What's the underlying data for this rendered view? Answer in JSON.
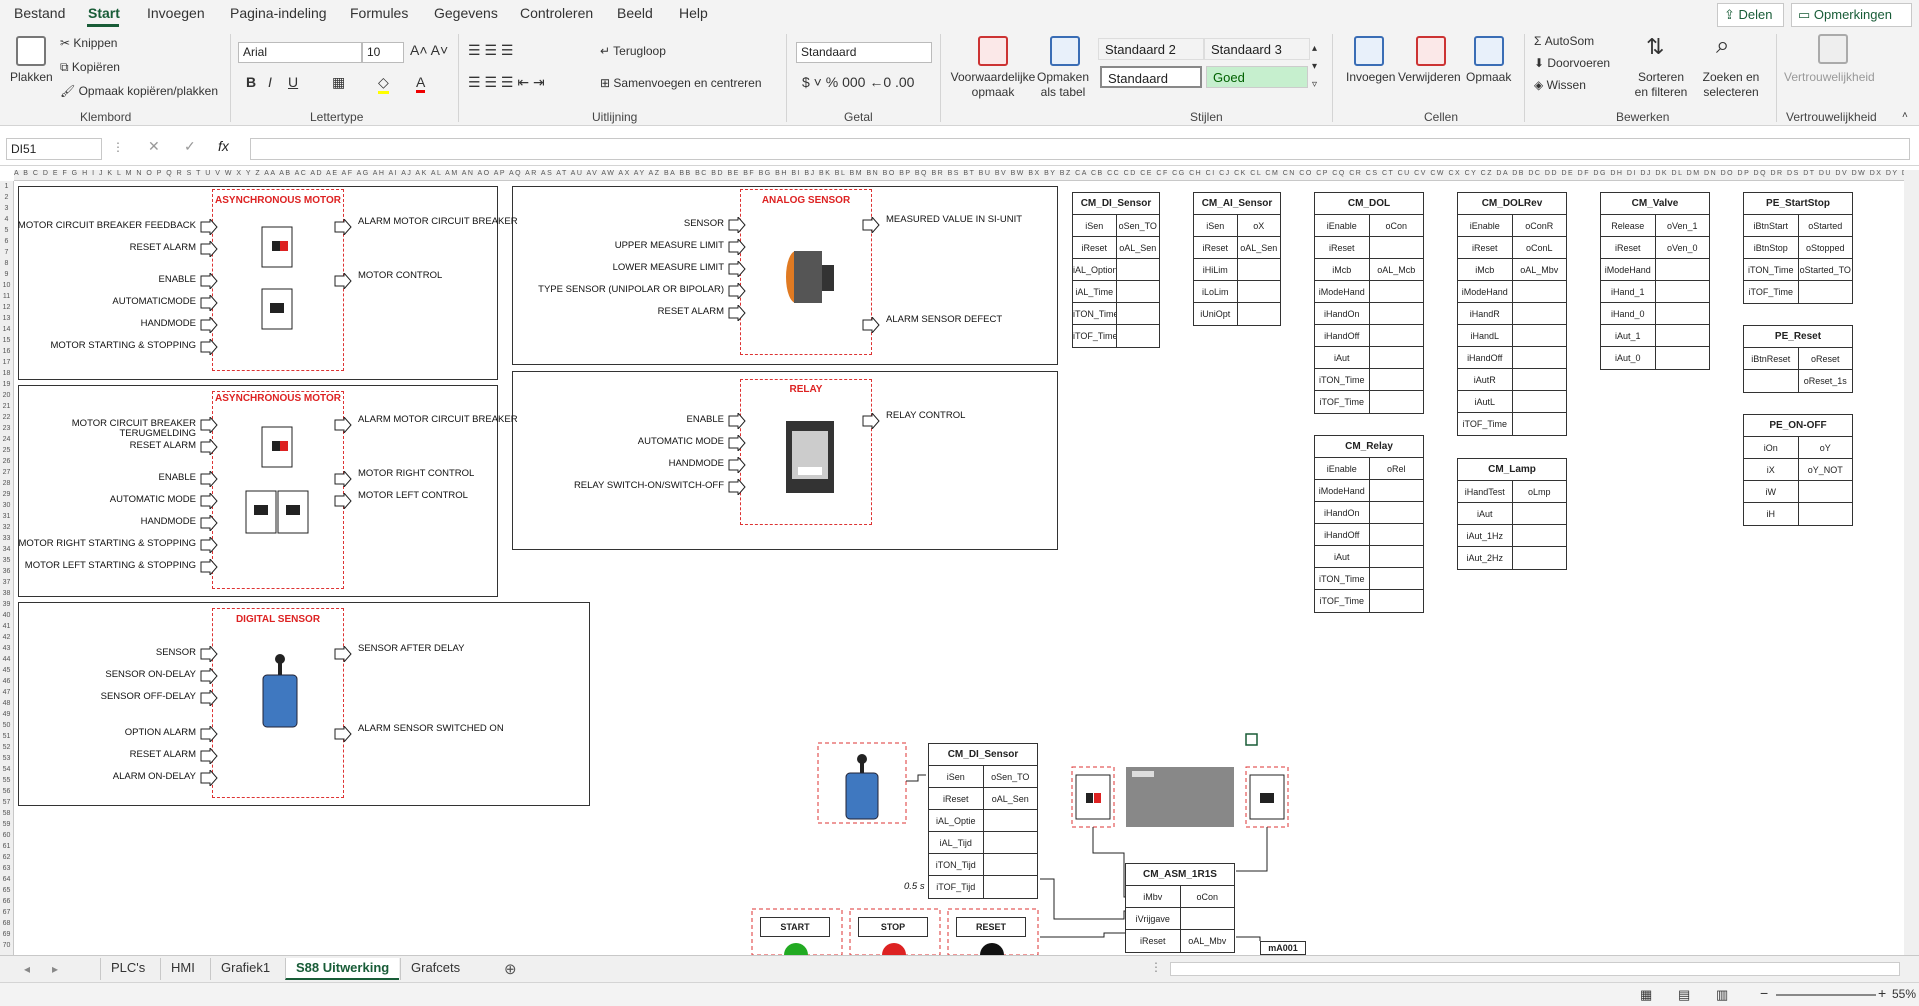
{
  "menu": [
    "Bestand",
    "Start",
    "Invoegen",
    "Pagina-indeling",
    "Formules",
    "Gegevens",
    "Controleren",
    "Beeld",
    "Help"
  ],
  "share_label": "Delen",
  "comments_label": "Opmerkingen",
  "ribbon": {
    "paste": "Plakken",
    "cut": "Knippen",
    "copy": "Kopiëren",
    "format_painter": "Opmaak kopiëren/plakken",
    "font_name": "Arial",
    "font_size": "10",
    "wrap": "Terugloop",
    "merge": "Samenvoegen en centreren",
    "number_format": "Standaard",
    "cond_format": "Voorwaardelijke opmaak",
    "format_table": "Opmaken als tabel",
    "style1": "Standaard 2",
    "style2": "Standaard 3",
    "style3": "Standaard",
    "style4": "Goed",
    "insert": "Invoegen",
    "delete": "Verwijderen",
    "format": "Opmaak",
    "autosum": "AutoSom",
    "fill": "Doorvoeren",
    "clear": "Wissen",
    "sort": "Sorteren en filteren",
    "find": "Zoeken en selecteren",
    "sensitivity": "Vertrouwelijkheid",
    "groups": [
      "Klembord",
      "Lettertype",
      "Uitlijning",
      "Getal",
      "Stijlen",
      "Cellen",
      "Bewerken",
      "Vertrouwelijkheid"
    ]
  },
  "namebox": "DI51",
  "sheet_tabs": [
    "PLC's",
    "HMI",
    "Grafiek1",
    "S88 Uitwerking",
    "Grafcets"
  ],
  "zoom": "55%",
  "blocks": {
    "motor1": {
      "title": "ASYNCHRONOUS MOTOR",
      "inputs": [
        "MOTOR CIRCUIT BREAKER FEEDBACK",
        "RESET ALARM",
        "ENABLE",
        "AUTOMATICMODE",
        "HANDMODE",
        "MOTOR STARTING & STOPPING"
      ],
      "outputs": [
        "ALARM MOTOR CIRCUIT BREAKER",
        "MOTOR CONTROL"
      ]
    },
    "motor2": {
      "title": "ASYNCHRONOUS MOTOR",
      "inputs": [
        "MOTOR CIRCUIT BREAKER TERUGMELDING",
        "RESET ALARM",
        "ENABLE",
        "AUTOMATIC MODE",
        "HANDMODE",
        "MOTOR RIGHT STARTING & STOPPING",
        "MOTOR LEFT STARTING & STOPPING"
      ],
      "outputs": [
        "ALARM MOTOR CIRCUIT BREAKER",
        "MOTOR RIGHT CONTROL",
        "MOTOR LEFT CONTROL"
      ]
    },
    "digital": {
      "title": "DIGITAL SENSOR",
      "inputs": [
        "SENSOR",
        "SENSOR ON-DELAY",
        "SENSOR OFF-DELAY",
        "OPTION ALARM",
        "RESET ALARM",
        "ALARM ON-DELAY"
      ],
      "outputs": [
        "SENSOR AFTER DELAY",
        "ALARM SENSOR SWITCHED ON"
      ]
    },
    "analog": {
      "title": "ANALOG SENSOR",
      "inputs": [
        "SENSOR",
        "UPPER MEASURE LIMIT",
        "LOWER MEASURE LIMIT",
        "TYPE SENSOR (UNIPOLAR OR BIPOLAR)",
        "RESET ALARM"
      ],
      "outputs": [
        "MEASURED VALUE IN SI-UNIT",
        "ALARM SENSOR DEFECT"
      ]
    },
    "relay": {
      "title": "RELAY",
      "inputs": [
        "ENABLE",
        "AUTOMATIC MODE",
        "HANDMODE",
        "RELAY SWITCH-ON/SWITCH-OFF"
      ],
      "outputs": [
        "RELAY CONTROL"
      ]
    }
  },
  "fbs": [
    {
      "title": "CM_DI_Sensor",
      "rows": [
        [
          "iSen",
          "oSen_TO"
        ],
        [
          "iReset",
          "oAL_Sen"
        ],
        [
          "iAL_Option",
          ""
        ],
        [
          "iAL_Time",
          ""
        ],
        [
          "iTON_Time",
          ""
        ],
        [
          "iTOF_Time",
          ""
        ]
      ]
    },
    {
      "title": "CM_AI_Sensor",
      "rows": [
        [
          "iSen",
          "oX"
        ],
        [
          "iReset",
          "oAL_Sen"
        ],
        [
          "iHiLim",
          ""
        ],
        [
          "iLoLim",
          ""
        ],
        [
          "iUniOpt",
          ""
        ]
      ]
    },
    {
      "title": "CM_DOL",
      "rows": [
        [
          "iEnable",
          "oCon"
        ],
        [
          "iReset",
          ""
        ],
        [
          "iMcb",
          "oAL_Mcb"
        ],
        [
          "iModeHand",
          ""
        ],
        [
          "iHandOn",
          ""
        ],
        [
          "iHandOff",
          ""
        ],
        [
          "iAut",
          ""
        ],
        [
          "iTON_Time",
          ""
        ],
        [
          "iTOF_Time",
          ""
        ]
      ]
    },
    {
      "title": "CM_DOLRev",
      "rows": [
        [
          "iEnable",
          "oConR"
        ],
        [
          "iReset",
          "oConL"
        ],
        [
          "iMcb",
          "oAL_Mbv"
        ],
        [
          "iModeHand",
          ""
        ],
        [
          "iHandR",
          ""
        ],
        [
          "iHandL",
          ""
        ],
        [
          "iHandOff",
          ""
        ],
        [
          "iAutR",
          ""
        ],
        [
          "iAutL",
          ""
        ],
        [
          "iTOF_Time",
          ""
        ]
      ]
    },
    {
      "title": "CM_Valve",
      "rows": [
        [
          "Release",
          "oVen_1"
        ],
        [
          "iReset",
          "oVen_0"
        ],
        [
          "iModeHand",
          ""
        ],
        [
          "iHand_1",
          ""
        ],
        [
          "iHand_0",
          ""
        ],
        [
          "iAut_1",
          ""
        ],
        [
          "iAut_0",
          ""
        ]
      ]
    },
    {
      "title": "PE_StartStop",
      "rows": [
        [
          "iBtnStart",
          "oStarted"
        ],
        [
          "iBtnStop",
          "oStopped"
        ],
        [
          "iTON_Time",
          "oStarted_TO"
        ],
        [
          "iTOF_Time",
          ""
        ]
      ]
    },
    {
      "title": "PE_Reset",
      "rows": [
        [
          "iBtnReset",
          "oReset"
        ],
        [
          "",
          "oReset_1s"
        ]
      ]
    },
    {
      "title": "PE_ON-OFF",
      "rows": [
        [
          "iOn",
          "oY"
        ],
        [
          "iX",
          "oY_NOT"
        ],
        [
          "iW",
          ""
        ],
        [
          "iH",
          ""
        ]
      ]
    },
    {
      "title": "CM_Relay",
      "rows": [
        [
          "iEnable",
          "oRel"
        ],
        [
          "iModeHand",
          ""
        ],
        [
          "iHandOn",
          ""
        ],
        [
          "iHandOff",
          ""
        ],
        [
          "iAut",
          ""
        ],
        [
          "iTON_Time",
          ""
        ],
        [
          "iTOF_Time",
          ""
        ]
      ]
    },
    {
      "title": "CM_Lamp",
      "rows": [
        [
          "iHandTest",
          "oLmp"
        ],
        [
          "iAut",
          ""
        ],
        [
          "iAut_1Hz",
          ""
        ],
        [
          "iAut_2Hz",
          ""
        ]
      ]
    },
    {
      "title": "CM_DI_Sensor",
      "rows": [
        [
          "iSen",
          "oSen_TO"
        ],
        [
          "iReset",
          "oAL_Sen"
        ],
        [
          "iAL_Optie",
          ""
        ],
        [
          "iAL_Tijd",
          ""
        ],
        [
          "iTON_Tijd",
          ""
        ],
        [
          "iTOF_Tijd",
          ""
        ]
      ]
    },
    {
      "title": "CM_ASM_1R1S",
      "rows": [
        [
          "iMbv",
          "oCon"
        ],
        [
          "iVrijgave",
          ""
        ],
        [
          "iReset",
          "oAL_Mbv"
        ]
      ]
    }
  ],
  "delay_note": "0.5 s",
  "buttons": [
    "START",
    "STOP",
    "RESET"
  ],
  "ma_label": "mA001"
}
